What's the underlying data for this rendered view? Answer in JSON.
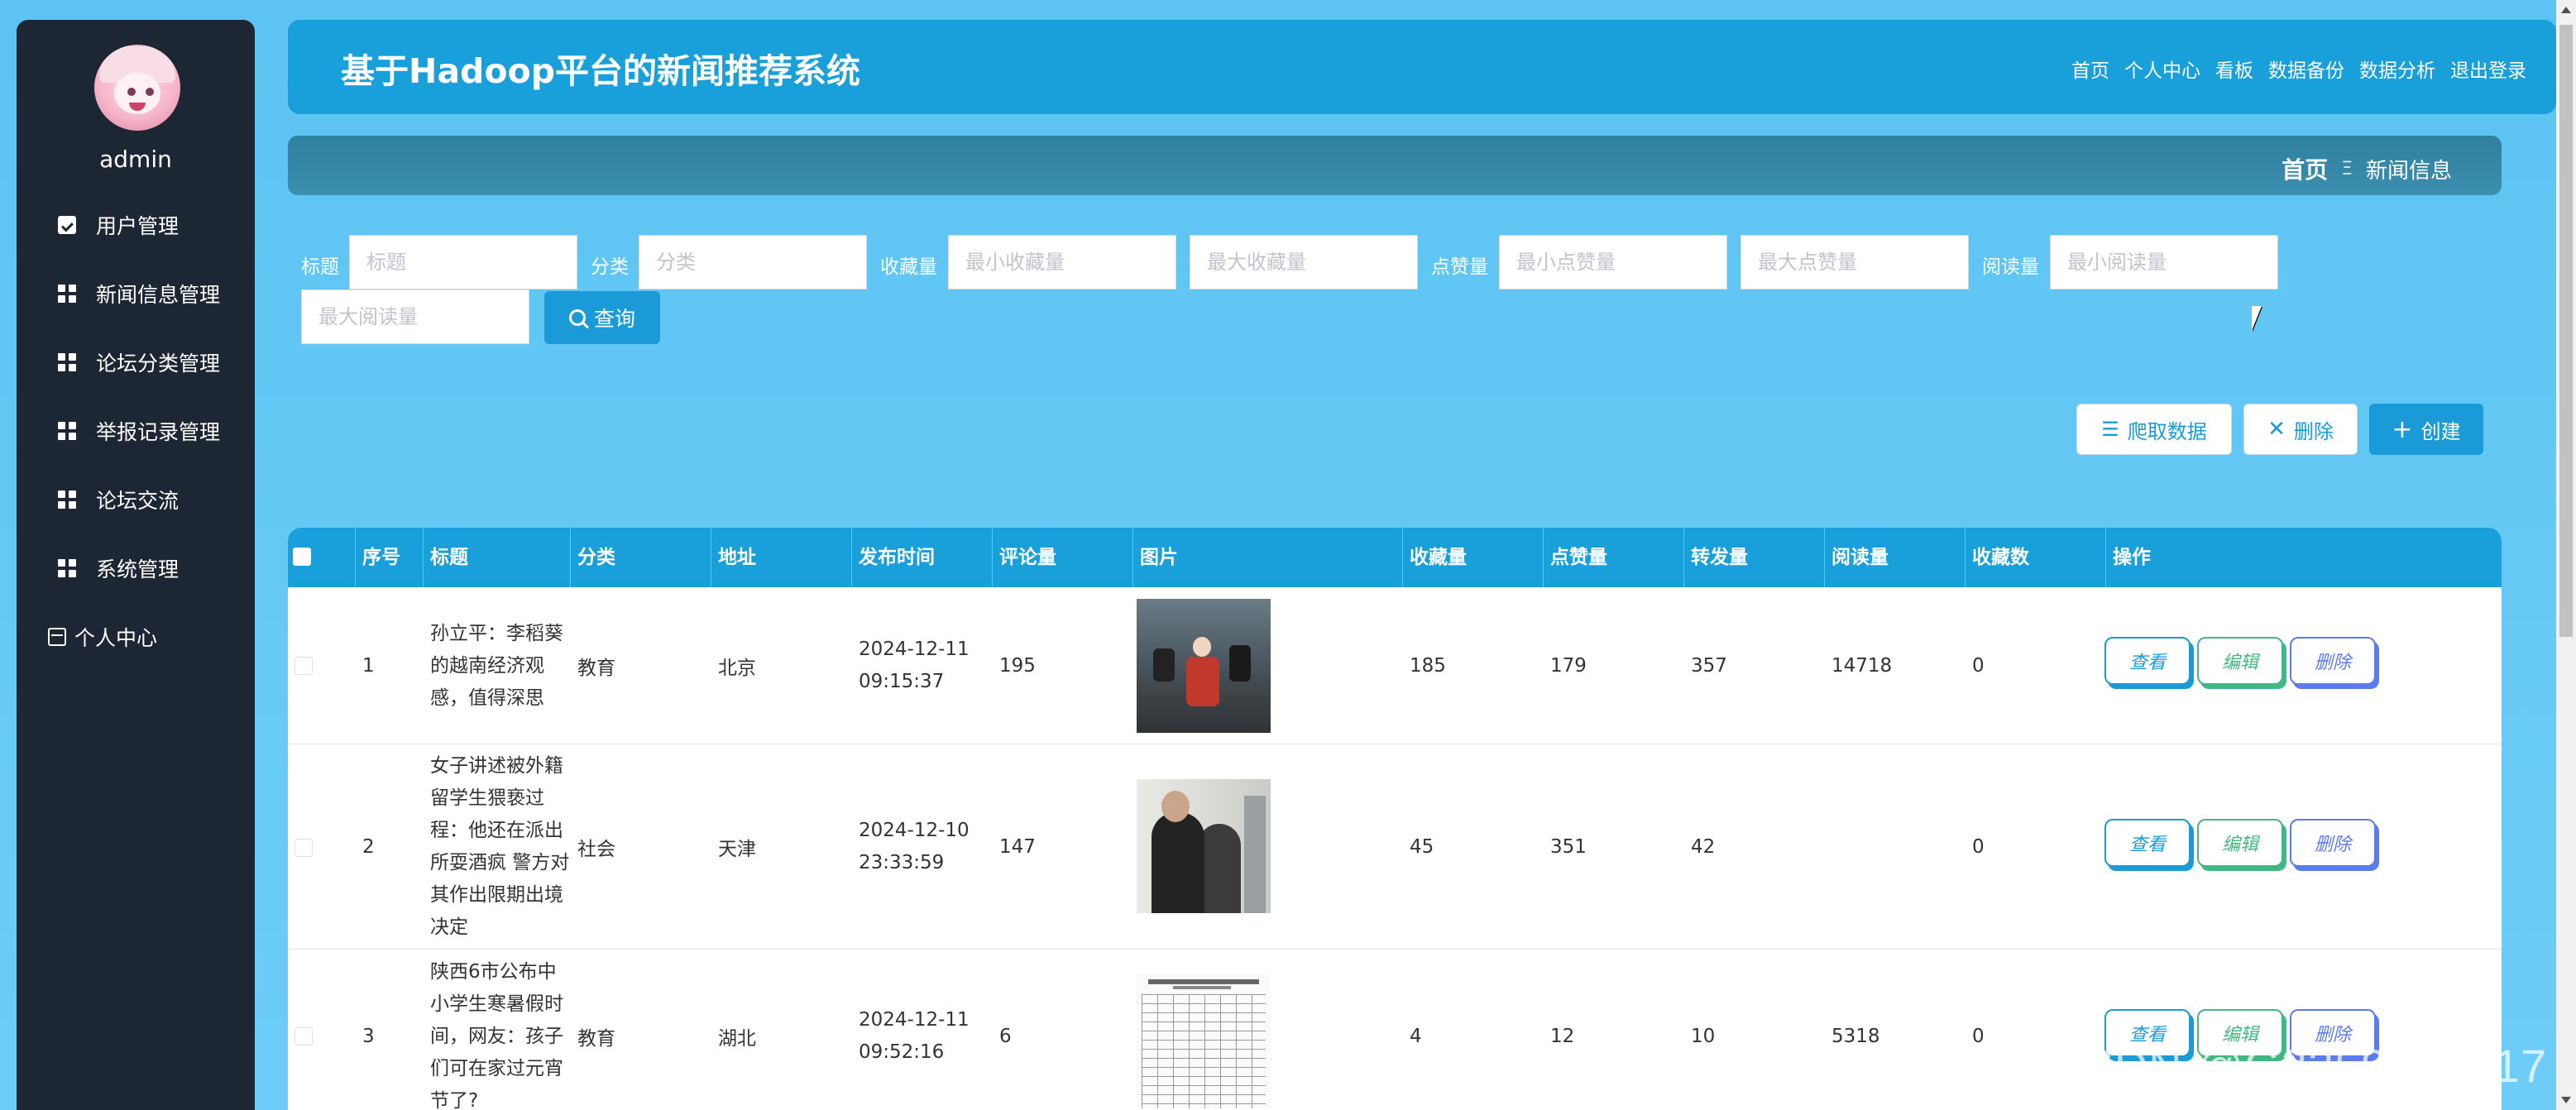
{
  "sidebar": {
    "username": "admin",
    "items": [
      {
        "label": "用户管理",
        "icon": "clipboard-check-icon"
      },
      {
        "label": "新闻信息管理",
        "icon": "grid-icon"
      },
      {
        "label": "论坛分类管理",
        "icon": "grid-icon"
      },
      {
        "label": "举报记录管理",
        "icon": "grid-icon"
      },
      {
        "label": "论坛交流",
        "icon": "grid-icon"
      },
      {
        "label": "系统管理",
        "icon": "grid-icon"
      },
      {
        "label": "个人中心",
        "icon": "user-card-icon"
      }
    ]
  },
  "header": {
    "title": "基于Hadoop平台的新闻推荐系统",
    "links": [
      "首页",
      "个人中心",
      "看板",
      "数据备份",
      "数据分析",
      "退出登录"
    ]
  },
  "breadcrumb": {
    "home": "首页",
    "separator": "Ξ",
    "current": "新闻信息"
  },
  "search": {
    "title_label": "标题",
    "title_placeholder": "标题",
    "category_label": "分类",
    "category_placeholder": "分类",
    "collect_label": "收藏量",
    "collect_min_placeholder": "最小收藏量",
    "collect_max_placeholder": "最大收藏量",
    "like_label": "点赞量",
    "like_min_placeholder": "最小点赞量",
    "like_max_placeholder": "最大点赞量",
    "read_label": "阅读量",
    "read_min_placeholder": "最小阅读量",
    "read_max_placeholder": "最大阅读量",
    "query_label": "查询"
  },
  "actions": {
    "crawl_label": "爬取数据",
    "delete_label": "删除",
    "create_label": "创建"
  },
  "table": {
    "headers": [
      "序号",
      "标题",
      "分类",
      "地址",
      "发布时间",
      "评论量",
      "图片",
      "收藏量",
      "点赞量",
      "转发量",
      "阅读量",
      "收藏数",
      "操作"
    ],
    "rows": [
      {
        "no": "1",
        "title": "孙立平：李稻葵的越南经济观感，值得深思",
        "category": "教育",
        "address": "北京",
        "time": "2024-12-11 09:15:37",
        "comments": "195",
        "collects": "185",
        "likes": "179",
        "forwards": "357",
        "reads": "14718",
        "fav": "0"
      },
      {
        "no": "2",
        "title": "女子讲述被外籍留学生猥亵过程：他还在派出所耍酒疯 警方对其作出限期出境决定",
        "category": "社会",
        "address": "天津",
        "time": "2024-12-10 23:33:59",
        "comments": "147",
        "collects": "45",
        "likes": "351",
        "forwards": "42",
        "reads": "",
        "fav": "0"
      },
      {
        "no": "3",
        "title": "陕西6市公布中小学生寒暑假时间，网友：孩子们可在家过元宵节了?",
        "category": "教育",
        "address": "湖北",
        "time": "2024-12-11 09:52:16",
        "comments": "6",
        "collects": "4",
        "likes": "12",
        "forwards": "10",
        "reads": "5318",
        "fav": "0"
      }
    ],
    "op_view": "查看",
    "op_edit": "编辑",
    "op_delete": "删除"
  },
  "watermark": "CSDN @G3259093417",
  "colors": {
    "primary": "#199fd9",
    "sidebar": "#1d2733",
    "edit": "#41b883",
    "delete": "#5b7cf0"
  }
}
